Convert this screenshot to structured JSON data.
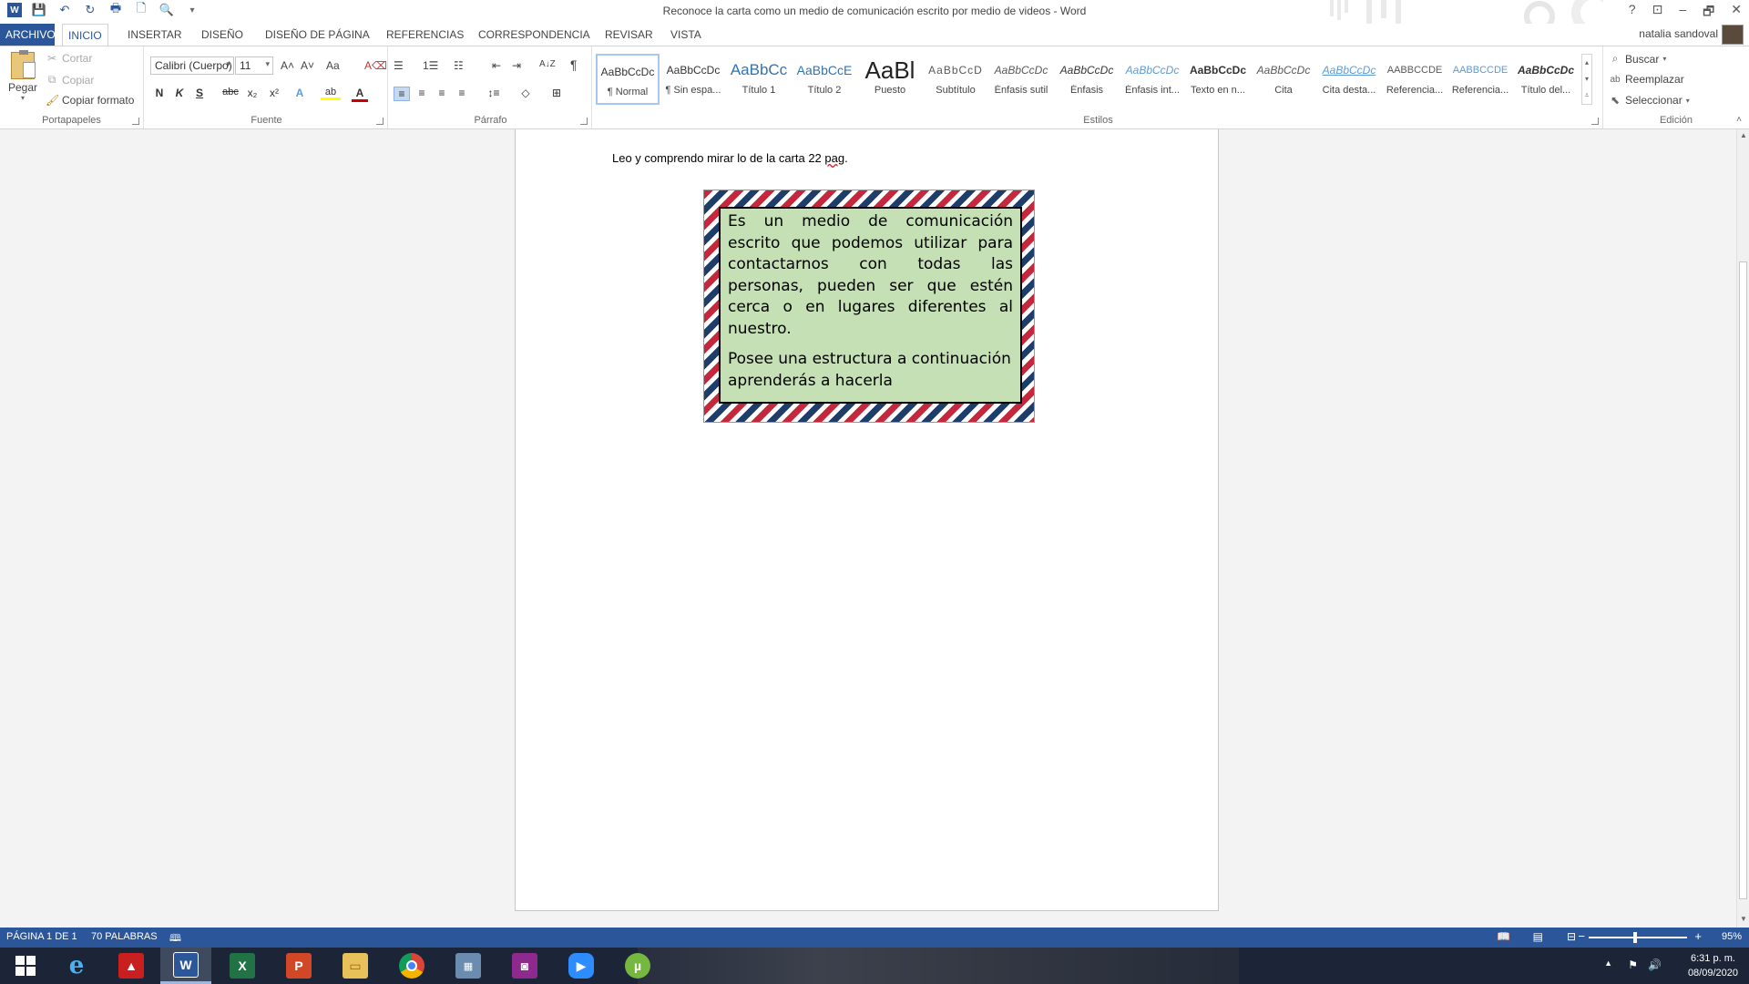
{
  "window": {
    "title": "Reconoce la carta como un medio de comunicación escrito por medio de videos - Word",
    "help": "?",
    "minimize": "–",
    "restore": "🗗",
    "close": "✕"
  },
  "quick_access": {
    "word_logo": "W",
    "save": "💾",
    "undo": "↶",
    "redo": "↻",
    "print": "🖶",
    "new": "🗋",
    "preview": "🔍",
    "customize": "▾"
  },
  "tabs": [
    "ARCHIVO",
    "INICIO",
    "INSERTAR",
    "DISEÑO",
    "DISEÑO DE PÁGINA",
    "REFERENCIAS",
    "CORRESPONDENCIA",
    "REVISAR",
    "VISTA"
  ],
  "active_tab": "INICIO",
  "user": {
    "name": "natalia sandoval"
  },
  "ribbon": {
    "clipboard": {
      "label": "Portapapeles",
      "paste": "Pegar",
      "cut": "Cortar",
      "copy": "Copiar",
      "format_painter": "Copiar formato"
    },
    "font": {
      "label": "Fuente",
      "font_name": "Calibri (Cuerpo)",
      "font_size": "11",
      "grow": "A˄",
      "shrink": "A˅",
      "case": "Aa",
      "clear": "A⌫",
      "bold": "N",
      "italic": "K",
      "underline": "S",
      "strike": "abc",
      "subscript": "x₂",
      "superscript": "x²",
      "effects": "A",
      "highlight": "ab",
      "color": "A"
    },
    "paragraph": {
      "label": "Párrafo",
      "bullets": "☰",
      "numbering": "1☰",
      "multilevel": "☷",
      "decrease": "⇤",
      "increase": "⇥",
      "sort": "A↓Z",
      "show_marks": "¶",
      "align_left": "≡",
      "center": "≡",
      "align_right": "≡",
      "justify": "≡",
      "spacing": "↕≡",
      "shading": "◇",
      "borders": "⊞"
    },
    "styles": {
      "label": "Estilos",
      "items": [
        {
          "sample": "AaBbCcDc",
          "name": "¶ Normal"
        },
        {
          "sample": "AaBbCcDc",
          "name": "¶ Sin espa..."
        },
        {
          "sample": "AaBbCc",
          "name": "Título 1"
        },
        {
          "sample": "AaBbCcE",
          "name": "Título 2"
        },
        {
          "sample": "AaBl",
          "name": "Puesto"
        },
        {
          "sample": "AaBbCcD",
          "name": "Subtítulo"
        },
        {
          "sample": "AaBbCcDc",
          "name": "Énfasis sutil"
        },
        {
          "sample": "AaBbCcDc",
          "name": "Énfasis"
        },
        {
          "sample": "AaBbCcDc",
          "name": "Énfasis int..."
        },
        {
          "sample": "AaBbCcDc",
          "name": "Texto en n..."
        },
        {
          "sample": "AaBbCcDc",
          "name": "Cita"
        },
        {
          "sample": "AaBbCcDc",
          "name": "Cita desta..."
        },
        {
          "sample": "AABBCCDE",
          "name": "Referencia..."
        },
        {
          "sample": "AABBCCDE",
          "name": "Referencia..."
        },
        {
          "sample": "AaBbCcDc",
          "name": "Título del..."
        }
      ],
      "selected_index": 0,
      "colors": {
        "heading": "#2e74b5",
        "subtle": "#595959",
        "intense": "#5b9bd5"
      }
    },
    "editing": {
      "label": "Edición",
      "find": "Buscar",
      "replace": "Reemplazar",
      "select": "Seleccionar"
    }
  },
  "document": {
    "line_prefix": "Leo y comprendo mirar lo de la carta  22 ",
    "line_spell": "pag",
    "line_suffix": ".",
    "letter": {
      "paragraph1": "Es un medio de comunicación escrito que podemos utilizar para contactarnos con todas las personas, pueden ser que estén cerca o en lugares diferentes al nuestro.",
      "paragraph2": "Posee una estructura a continuación aprenderás a hacerla",
      "background": "#c5e0b4",
      "stripe_colors": [
        "#c5283d",
        "#1e3d6b"
      ]
    }
  },
  "status": {
    "page": "PÁGINA 1 DE 1",
    "words": "70 PALABRAS",
    "zoom": "95%",
    "zoom_level": 0.95
  },
  "taskbar": {
    "apps": [
      "start-icon",
      "internet-explorer-icon",
      "acrobat-icon",
      "word-icon",
      "excel-icon",
      "powerpoint-icon",
      "file-explorer-icon",
      "chrome-icon",
      "calculator-icon",
      "camera-app-icon",
      "zoom-icon",
      "utorrent-icon"
    ],
    "time": "6:31 p. m.",
    "date": "08/09/2020"
  },
  "theme": {
    "accent": "#2b579a",
    "taskbar": "#1c2538"
  }
}
